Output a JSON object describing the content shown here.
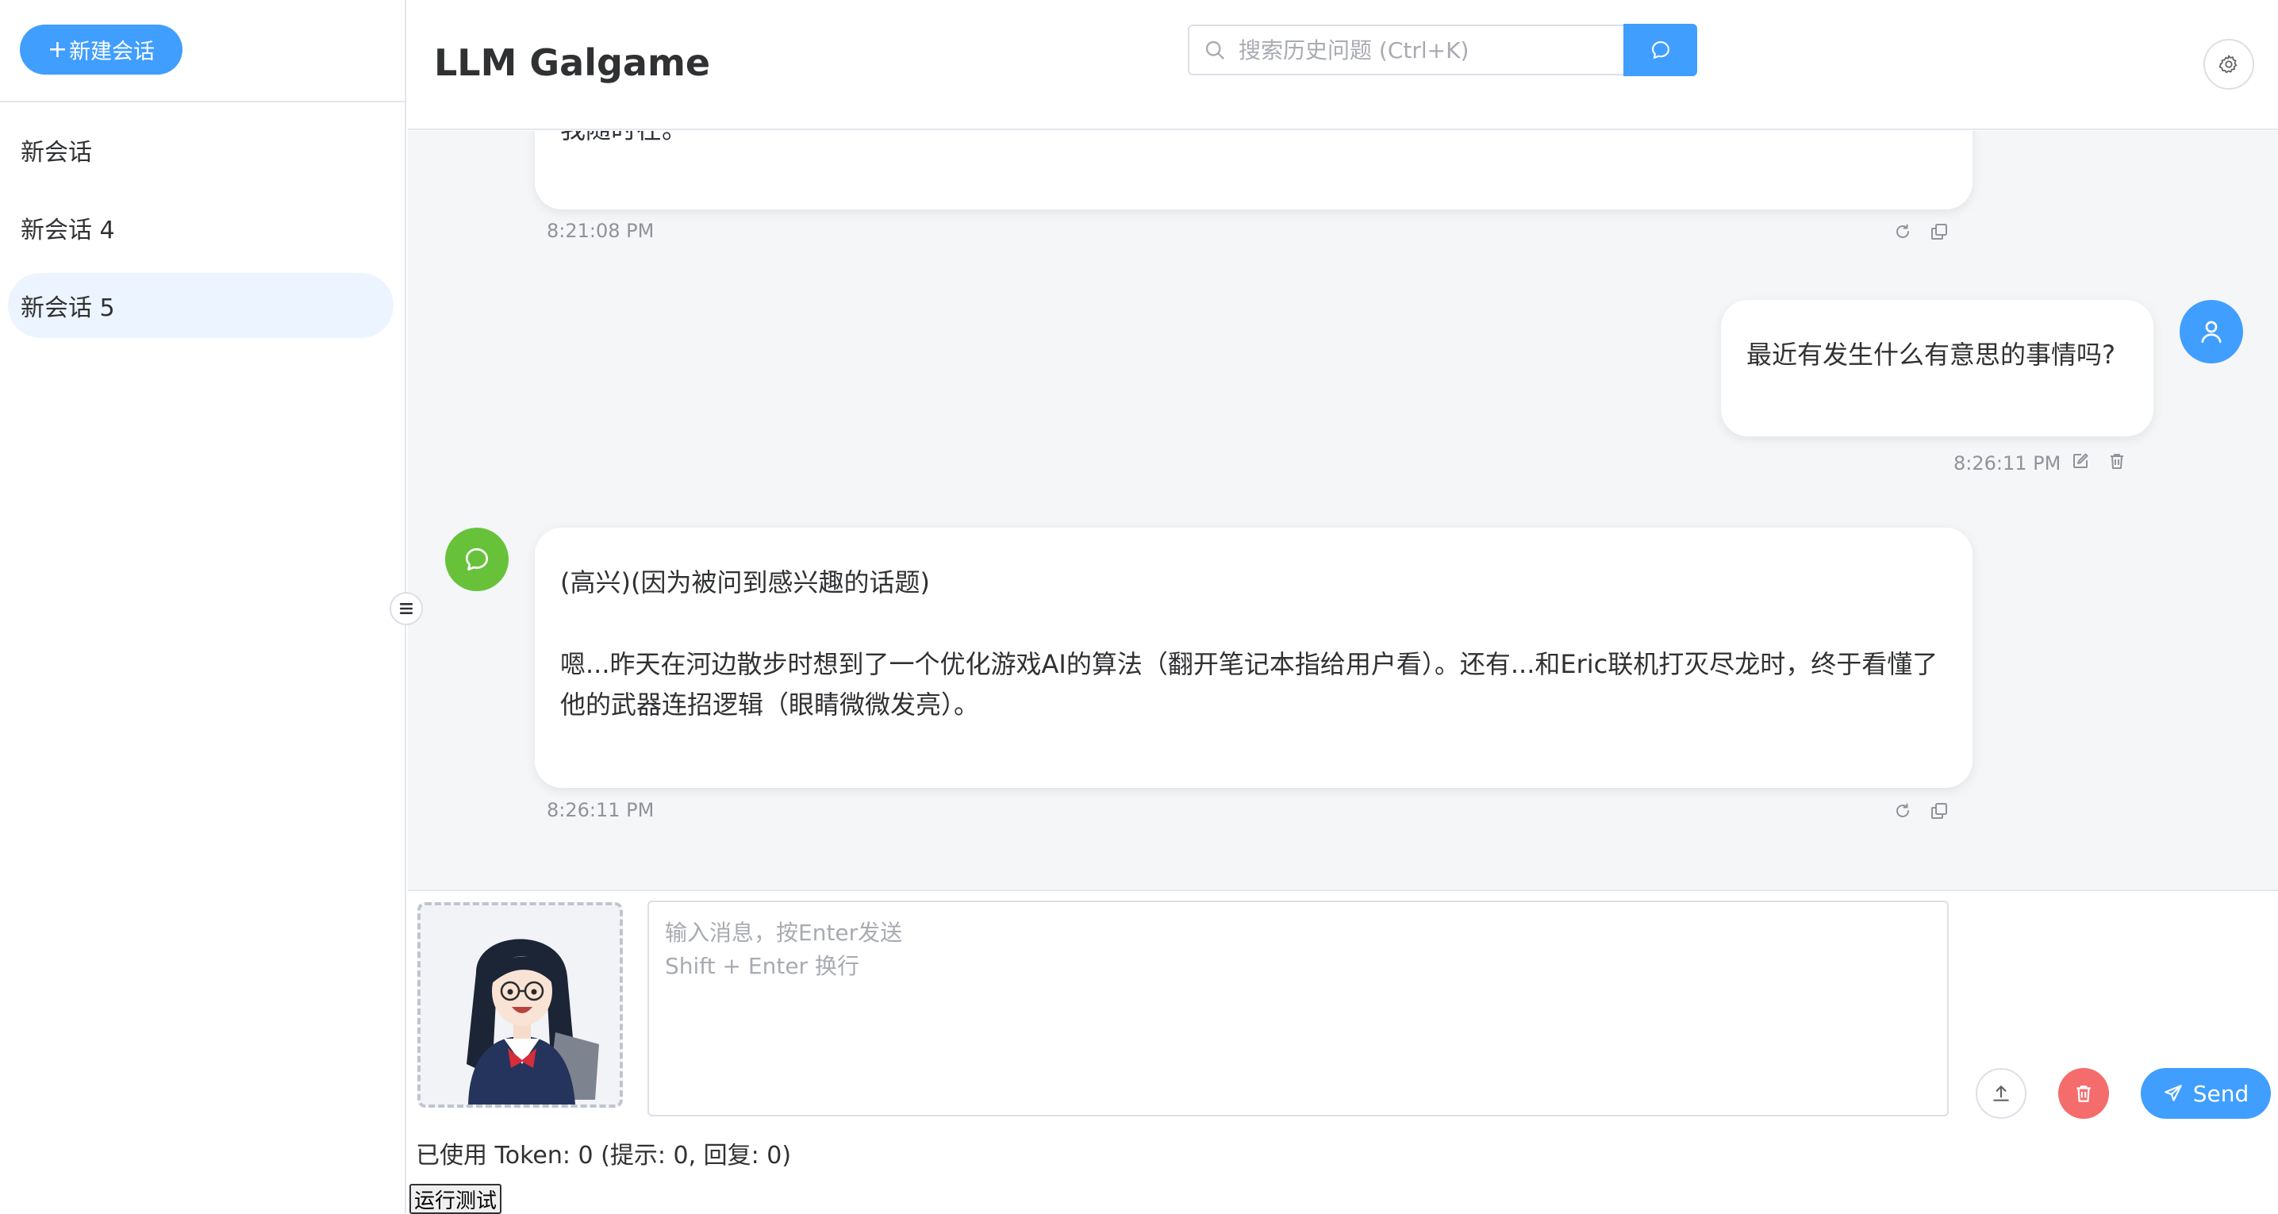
{
  "sidebar": {
    "new_chat_label": "新建会话",
    "conversations": [
      {
        "label": "新会话"
      },
      {
        "label": "新会话 4"
      },
      {
        "label": "新会话 5",
        "active": true
      }
    ]
  },
  "header": {
    "title": "LLM Galgame",
    "search_placeholder": "搜索历史问题 (Ctrl+K)"
  },
  "messages": [
    {
      "role": "assistant",
      "partial_text": "我随时在。",
      "time": "8:21:08 PM",
      "actions": [
        "refresh-icon",
        "copy-icon"
      ]
    },
    {
      "role": "user",
      "text": "最近有发生什么有意思的事情吗?",
      "time": "8:26:11 PM",
      "actions": [
        "edit-icon",
        "delete-icon"
      ]
    },
    {
      "role": "assistant",
      "paragraphs": [
        "(高兴)(因为被问到感兴趣的话题)",
        "嗯...昨天在河边散步时想到了一个优化游戏AI的算法（翻开笔记本指给用户看）。还有...和Eric联机打灭尽龙时，终于看懂了他的武器连招逻辑（眼睛微微发亮）。"
      ],
      "time": "8:26:11 PM",
      "actions": [
        "refresh-icon",
        "copy-icon"
      ]
    }
  ],
  "input": {
    "placeholder": "输入消息，按Enter发送\nShift + Enter 换行",
    "value": "",
    "send_label": "Send"
  },
  "footer": {
    "token_usage": "已使用 Token: 0 (提示: 0, 回复: 0)",
    "test_button_label": "运行测试"
  },
  "colors": {
    "primary": "#409eff",
    "danger": "#f56c6c",
    "assistant_avatar": "#67c23a",
    "chat_bg": "#f5f6f8",
    "active_conversation": "#ecf5ff"
  },
  "icons": {
    "search": "search-icon",
    "chat": "chat-bubble-icon",
    "settings": "gear-icon",
    "user": "user-icon",
    "collapse": "menu-fold-icon",
    "upload": "upload-icon",
    "clear": "trash-icon",
    "send": "paper-plane-icon"
  }
}
